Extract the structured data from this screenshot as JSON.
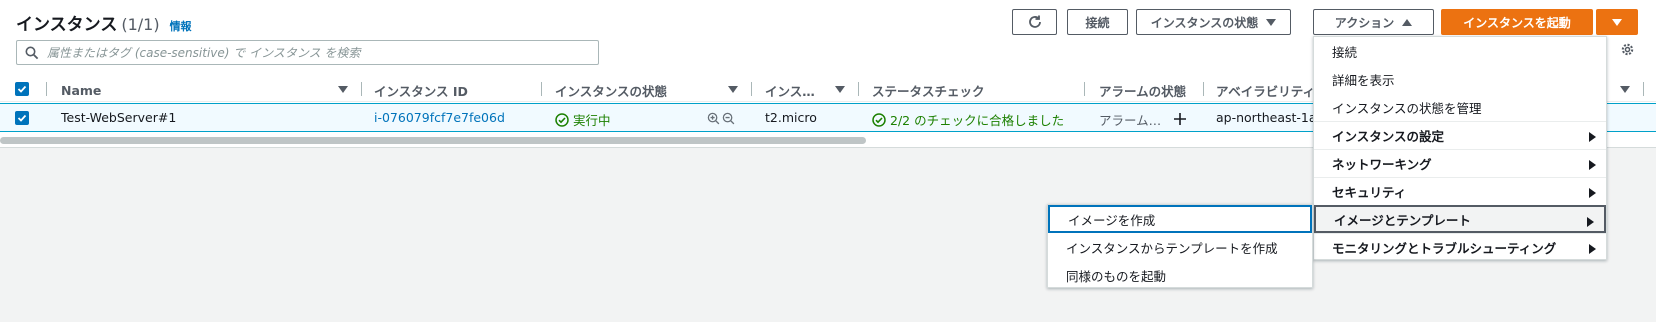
{
  "header": {
    "title": "インスタンス",
    "count": "(1/1)",
    "info_link": "情報"
  },
  "toolbar": {
    "refresh_icon": "refresh-icon",
    "connect_label": "接続",
    "instance_state_label": "インスタンスの状態",
    "actions_label": "アクション",
    "launch_label": "インスタンスを起動"
  },
  "search": {
    "placeholder": "属性またはタグ (case-sensitive) で インスタンス を検索",
    "value": ""
  },
  "table": {
    "columns": [
      "Name",
      "インスタンス ID",
      "インスタンスの状態",
      "インス…",
      "ステータスチェック",
      "アラームの状態",
      "アベイラビリティ"
    ],
    "rows": [
      {
        "name": "Test-WebServer#1",
        "instance_id": "i-076079fcf7e7fe06d",
        "state": "実行中",
        "instance_type": "t2.micro",
        "status_check": "2/2 のチェックに合格しました",
        "alarm_state": "アラーム…",
        "az": "ap-northeast-1a"
      }
    ]
  },
  "actions_menu": {
    "items": [
      {
        "label": "接続"
      },
      {
        "label": "詳細を表示"
      },
      {
        "label": "インスタンスの状態を管理"
      },
      {
        "label": "インスタンスの設定"
      },
      {
        "label": "ネットワーキング"
      },
      {
        "label": "セキュリティ"
      },
      {
        "label": "イメージとテンプレート"
      },
      {
        "label": "モニタリングとトラブルシューティング"
      }
    ]
  },
  "image_submenu": {
    "items": [
      {
        "label": "イメージを作成"
      },
      {
        "label": "インスタンスからテンプレートを作成"
      },
      {
        "label": "同様のものを起動"
      }
    ]
  },
  "colors": {
    "accent": "#0073bb",
    "primary_button": "#ec7211",
    "success": "#1d8102"
  }
}
